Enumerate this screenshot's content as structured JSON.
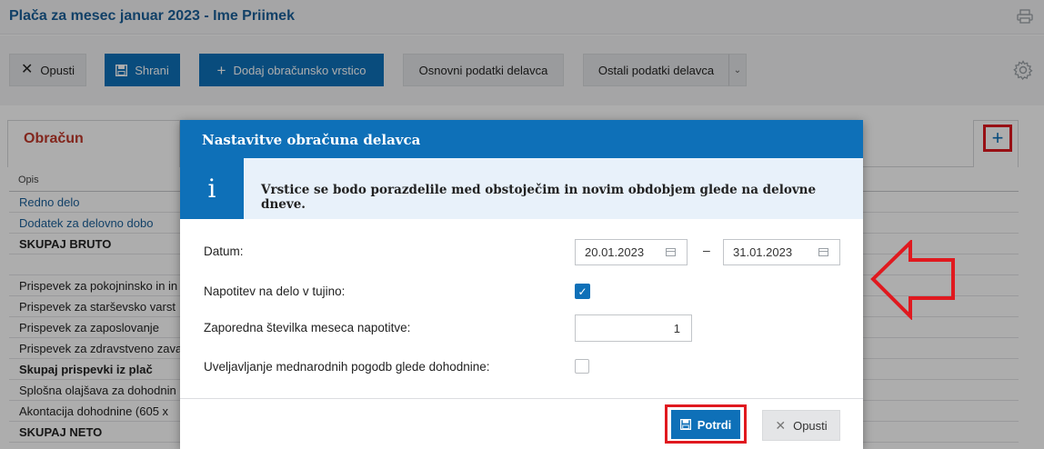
{
  "header": {
    "title": "Plača za mesec januar 2023 - Ime Priimek",
    "print_icon": "printer-icon"
  },
  "toolbar": {
    "cancel_label": "Opusti",
    "save_label": "Shrani",
    "add_row_label": "Dodaj obračunsko vrstico",
    "basic_data_label": "Osnovni podatki delavca",
    "other_data_label": "Ostali podatki delavca",
    "settings_icon": "gear-icon"
  },
  "panel": {
    "title": "Obračun",
    "add_icon": "plus-icon",
    "column_header": "Opis",
    "rows": [
      {
        "label": "Redno delo",
        "style": "link"
      },
      {
        "label": "Dodatek za delovno dobo",
        "style": "link"
      },
      {
        "label": "SKUPAJ BRUTO",
        "style": "bold"
      },
      {
        "label": "",
        "style": "plain"
      },
      {
        "label": "Prispevek za pokojninsko in in",
        "style": "plain"
      },
      {
        "label": "Prispevek za starševsko varst",
        "style": "plain"
      },
      {
        "label": "Prispevek za zaposlovanje",
        "style": "plain"
      },
      {
        "label": "Prispevek za zdravstveno zava",
        "style": "plain"
      },
      {
        "label": "Skupaj prispevki iz plač",
        "style": "bold"
      },
      {
        "label": "Splošna olajšava za dohodnin",
        "style": "plain"
      },
      {
        "label": "Akontacija dohodnine (605 x",
        "style": "plain"
      },
      {
        "label": "SKUPAJ NETO",
        "style": "bold"
      }
    ]
  },
  "modal": {
    "title": "Nastavitve obračuna delavca",
    "info_icon": "i",
    "info_text": "Vrstice se bodo porazdelile med obstoječim in novim obdobjem glede na delovne dneve.",
    "fields": {
      "date_label": "Datum:",
      "date_from": "20.01.2023",
      "date_separator": "–",
      "date_to": "31.01.2023",
      "abroad_label": "Napotitev na delo v tujino:",
      "abroad_checked": true,
      "month_no_label": "Zaporedna številka meseca napotitve:",
      "month_no_value": "1",
      "treaties_label": "Uveljavljanje mednarodnih pogodb glede dohodnine:",
      "treaties_checked": false
    },
    "confirm_label": "Potrdi",
    "cancel_label": "Opusti"
  },
  "colors": {
    "accent": "#0e70b8",
    "title_red": "#c0392b",
    "annotation_red": "#e0191f"
  }
}
